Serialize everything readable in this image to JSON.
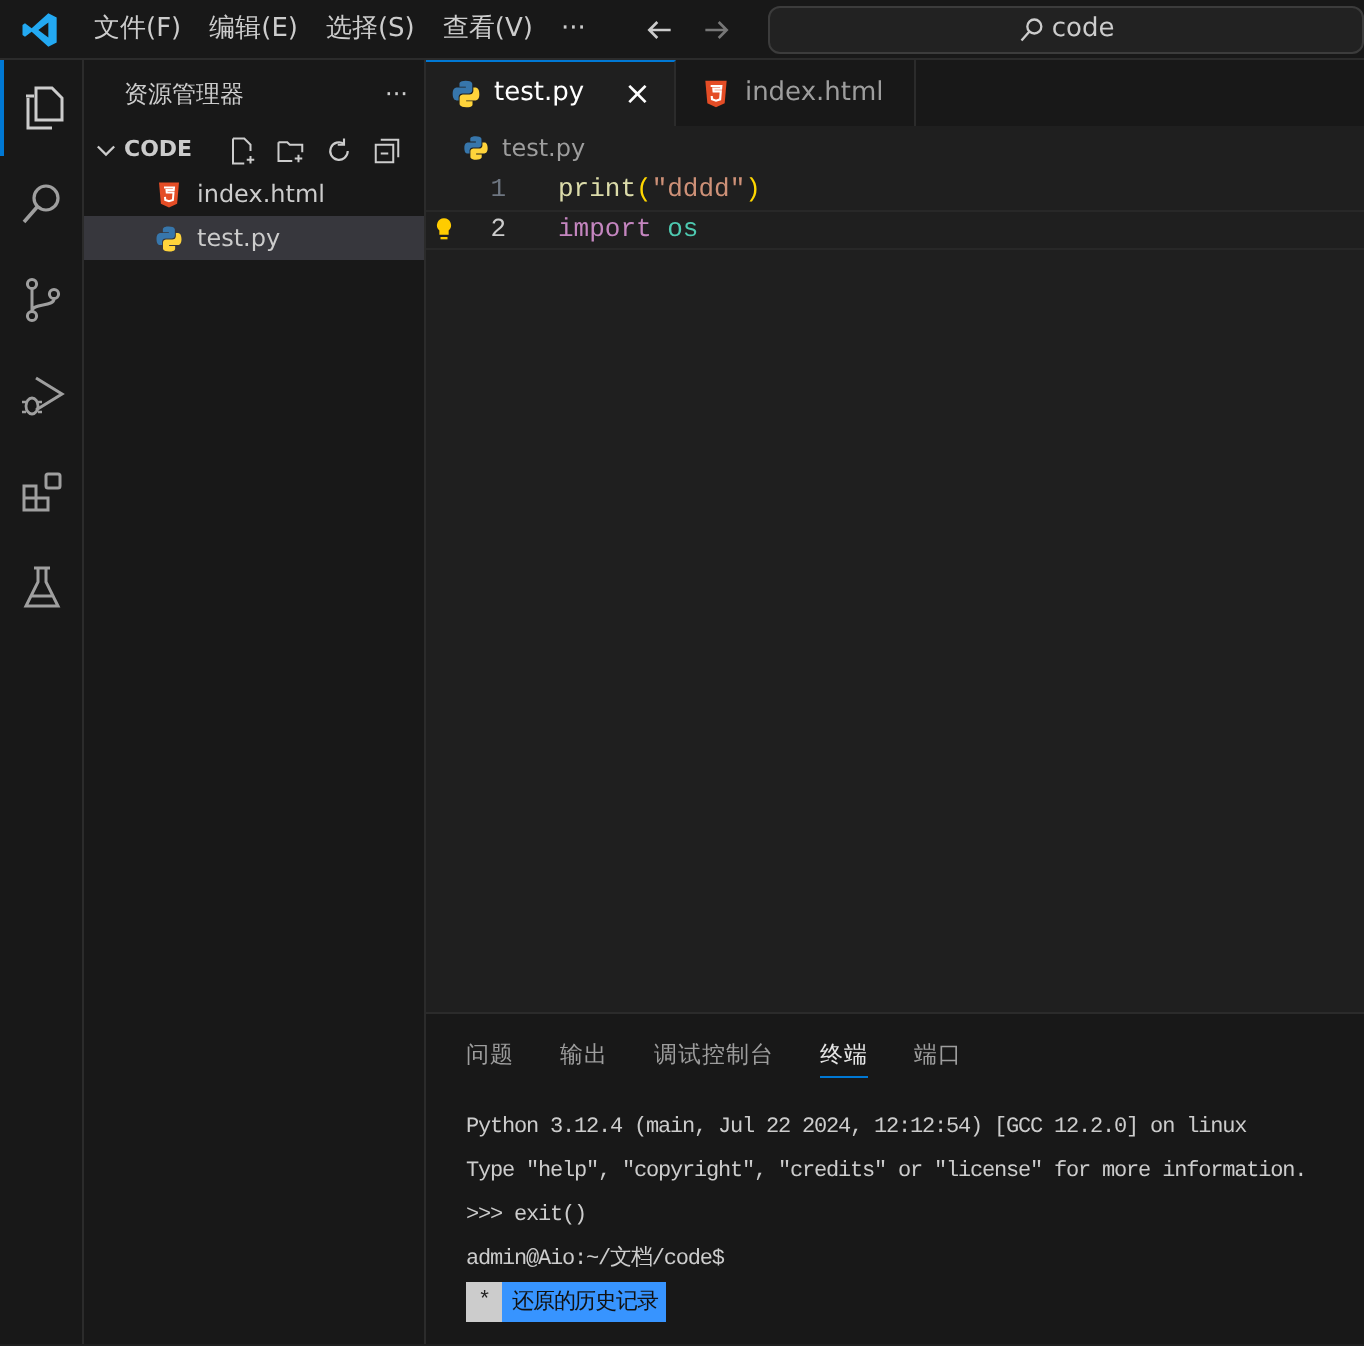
{
  "menu": [
    "文件(F)",
    "编辑(E)",
    "选择(S)",
    "查看(V)",
    "···"
  ],
  "search": {
    "value": "code"
  },
  "activity_bar": [
    {
      "kind": "files",
      "selected": true
    },
    {
      "kind": "search",
      "selected": false
    },
    {
      "kind": "git",
      "selected": false
    },
    {
      "kind": "debug",
      "selected": false
    },
    {
      "kind": "extensions",
      "selected": false
    },
    {
      "kind": "flask",
      "selected": false
    }
  ],
  "sidebar": {
    "title": "资源管理器",
    "more": "···",
    "folder": {
      "name": "CODE",
      "expanded": true,
      "children": [
        {
          "name": "index.html",
          "kind": "html",
          "selected": false
        },
        {
          "name": "test.py",
          "kind": "python",
          "selected": true
        }
      ]
    }
  },
  "tabs": [
    {
      "label": "test.py",
      "kind": "python",
      "selected": true,
      "close": "×"
    },
    {
      "label": "index.html",
      "kind": "html",
      "selected": false
    }
  ],
  "breadcrumb": {
    "label": "test.py",
    "kind": "python"
  },
  "code": [
    {
      "number": "1",
      "tokens": [
        {
          "text": "print",
          "kind": "function"
        },
        {
          "text": "(",
          "kind": "bracket"
        },
        {
          "text": "\"dddd\"",
          "kind": "string"
        },
        {
          "text": ")",
          "kind": "bracket"
        }
      ],
      "current": false,
      "lightbulb": false
    },
    {
      "number": "2",
      "tokens": [
        {
          "text": "import",
          "kind": "keyword"
        },
        {
          "text": "os",
          "kind": "module"
        }
      ],
      "current": true,
      "lightbulb": true
    }
  ],
  "panel": {
    "tabs": [
      {
        "label": "问题",
        "selected": false
      },
      {
        "label": "输出",
        "selected": false
      },
      {
        "label": "调试控制台",
        "selected": false
      },
      {
        "label": "终端",
        "selected": true
      },
      {
        "label": "端口",
        "selected": false
      }
    ],
    "terminal": [
      "Python 3.12.4 (main, Jul 22 2024, 12:12:54) [GCC 12.2.0] on linux",
      "Type \"help\", \"copyright\", \"credits\" or \"license\" for more information.",
      ">>> exit()",
      "admin@Aio:~/文档/code$"
    ],
    "suggestion": {
      "marker": "*",
      "label": "还原的历史记录"
    }
  }
}
